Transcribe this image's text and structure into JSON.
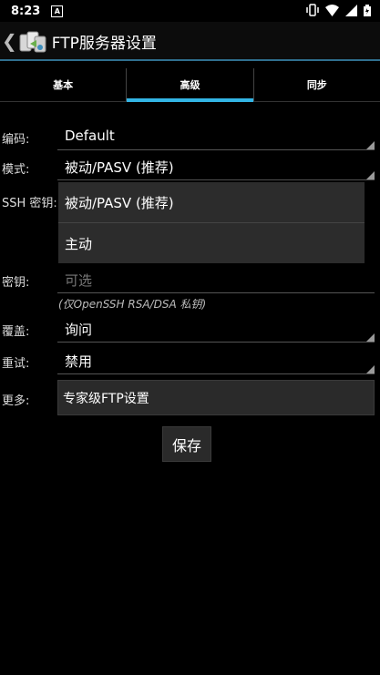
{
  "status_bar": {
    "time": "8:23",
    "notification_letter": "A"
  },
  "action_bar": {
    "back_glyph": "❮",
    "title": "FTP服务器设置"
  },
  "tabs": [
    {
      "label": "基本",
      "active": false
    },
    {
      "label": "高级",
      "active": true
    },
    {
      "label": "同步",
      "active": false
    }
  ],
  "form": {
    "encoding": {
      "label": "编码:",
      "value": "Default"
    },
    "mode": {
      "label": "模式:",
      "value": "被动/PASV (推荐)"
    },
    "ssh_key": {
      "label": "SSH 密钥:"
    },
    "key": {
      "label": "密钥:",
      "placeholder": "可选"
    },
    "key_hint": "(仅OpenSSH RSA/DSA 私钥)",
    "overwrite": {
      "label": "覆盖:",
      "value": "询问"
    },
    "retry": {
      "label": "重试:",
      "value": "禁用"
    },
    "more": {
      "label": "更多:",
      "button": "专家级FTP设置"
    }
  },
  "save_button": "保存",
  "mode_dropdown": {
    "options": [
      "被动/PASV (推荐)",
      "主动"
    ]
  }
}
